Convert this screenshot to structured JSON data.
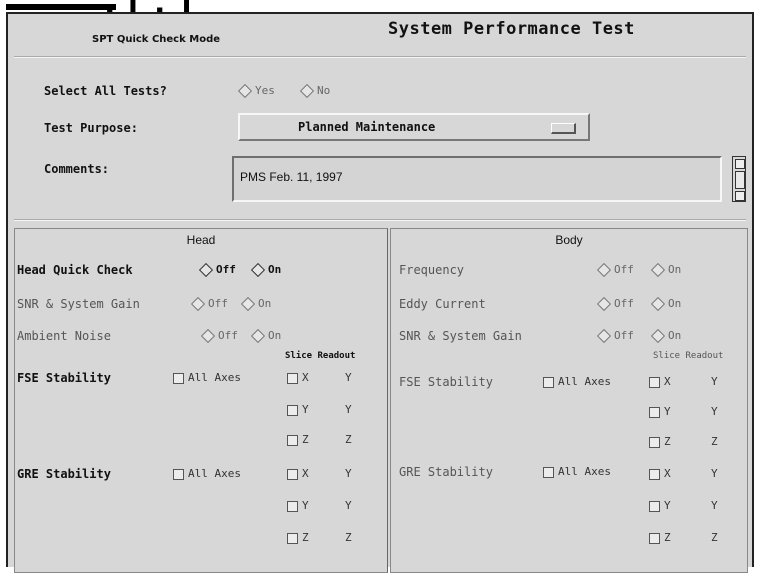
{
  "header": {
    "mode_label": "SPT Quick Check Mode",
    "title": "System Performance Test"
  },
  "form": {
    "select_all": {
      "label": "Select All Tests?",
      "options": [
        "Yes",
        "No"
      ]
    },
    "test_purpose": {
      "label": "Test Purpose:",
      "value": "Planned Maintenance"
    },
    "comments": {
      "label": "Comments:",
      "value": "PMS Feb. 11, 1997"
    }
  },
  "head_panel": {
    "title": "Head",
    "quick_check": {
      "label": "Head Quick Check",
      "off": "Off",
      "on": "On"
    },
    "snr": {
      "label": "SNR & System Gain",
      "off": "Off",
      "on": "On"
    },
    "ambient": {
      "label": "Ambient Noise",
      "off": "Off",
      "on": "On"
    },
    "slice_header": "Slice Readout",
    "fse": {
      "label": "FSE Stability",
      "all_axes": "All Axes",
      "axes": [
        "X",
        "Y",
        "Z"
      ],
      "readouts": [
        "Y",
        "Y",
        "Z"
      ]
    },
    "gre": {
      "label": "GRE Stability",
      "all_axes": "All Axes",
      "axes": [
        "X",
        "Y",
        "Z"
      ],
      "readouts": [
        "Y",
        "Y",
        "Z"
      ]
    }
  },
  "body_panel": {
    "title": "Body",
    "frequency": {
      "label": "Frequency",
      "off": "Off",
      "on": "On"
    },
    "eddy": {
      "label": "Eddy Current",
      "off": "Off",
      "on": "On"
    },
    "snr": {
      "label": "SNR & System Gain",
      "off": "Off",
      "on": "On"
    },
    "slice_header": "Slice Readout",
    "fse": {
      "label": "FSE Stability",
      "all_axes": "All Axes",
      "axes": [
        "X",
        "Y",
        "Z"
      ],
      "readouts": [
        "Y",
        "Y",
        "Z"
      ]
    },
    "gre": {
      "label": "GRE Stability",
      "all_axes": "All Axes",
      "axes": [
        "X",
        "Y",
        "Z"
      ],
      "readouts": [
        "Y",
        "Y",
        "Z"
      ]
    }
  },
  "colors": {
    "background": "#d7d7d7",
    "text": "#111111"
  }
}
